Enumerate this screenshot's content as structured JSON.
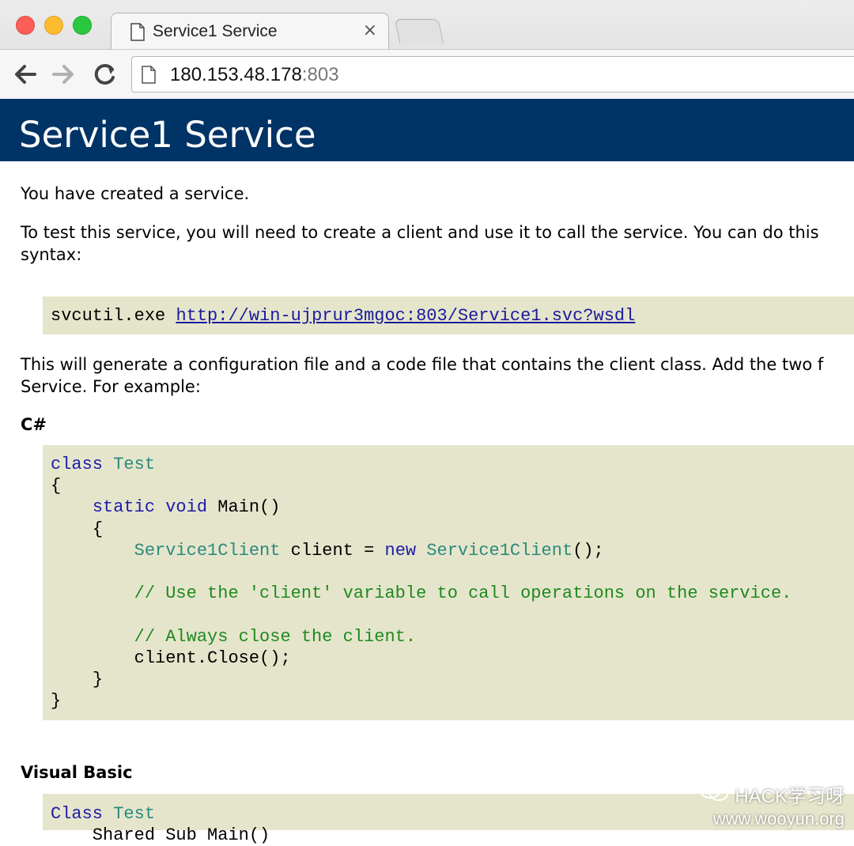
{
  "browser": {
    "tab_title": "Service1 Service",
    "tab_close": "×",
    "url_host": "180.153.48.178",
    "url_port": ":803"
  },
  "page": {
    "title": "Service1 Service",
    "intro": "You have created a service.",
    "test_line1": "To test this service, you will need to create a client and use it to call the service. You can do this",
    "test_line2": "syntax:",
    "svcutil_cmd": "svcutil.exe ",
    "wsdl_url": "http://win-ujprur3mgoc:803/Service1.svc?wsdl",
    "generate_line1": "This will generate a configuration file and a code file that contains the client class. Add the two f",
    "generate_line2": "Service. For example:",
    "csharp_heading": "C#",
    "vb_heading": "Visual Basic"
  },
  "csharp_code": {
    "kw_class": "class",
    "type_test": "Test",
    "open_brace": "{",
    "kw_static": "static",
    "kw_void": "void",
    "main_sig": "Main()",
    "inner_open": "{",
    "type_client1": "Service1Client",
    "decl_mid": " client = ",
    "kw_new": "new",
    "type_client2": "Service1Client",
    "call_end": "();",
    "comment_use": "// Use the 'client' variable to call operations on the service.",
    "comment_close": "// Always close the client.",
    "close_call": "client.Close();",
    "inner_close": "}",
    "close_brace": "}"
  },
  "vb_code": {
    "kw_class": "Class",
    "type_test": "Test",
    "line2": "    Shared Sub Main()"
  },
  "watermark": {
    "brand": "HACK学习呀",
    "site": "www.wooyun.org"
  },
  "colors": {
    "header_bg": "#003366",
    "code_bg": "#e5e5cc",
    "keyword": "#1c1ca8",
    "type": "#2b8a7a",
    "comment": "#1e8a1e",
    "link": "#1a1a9c"
  }
}
